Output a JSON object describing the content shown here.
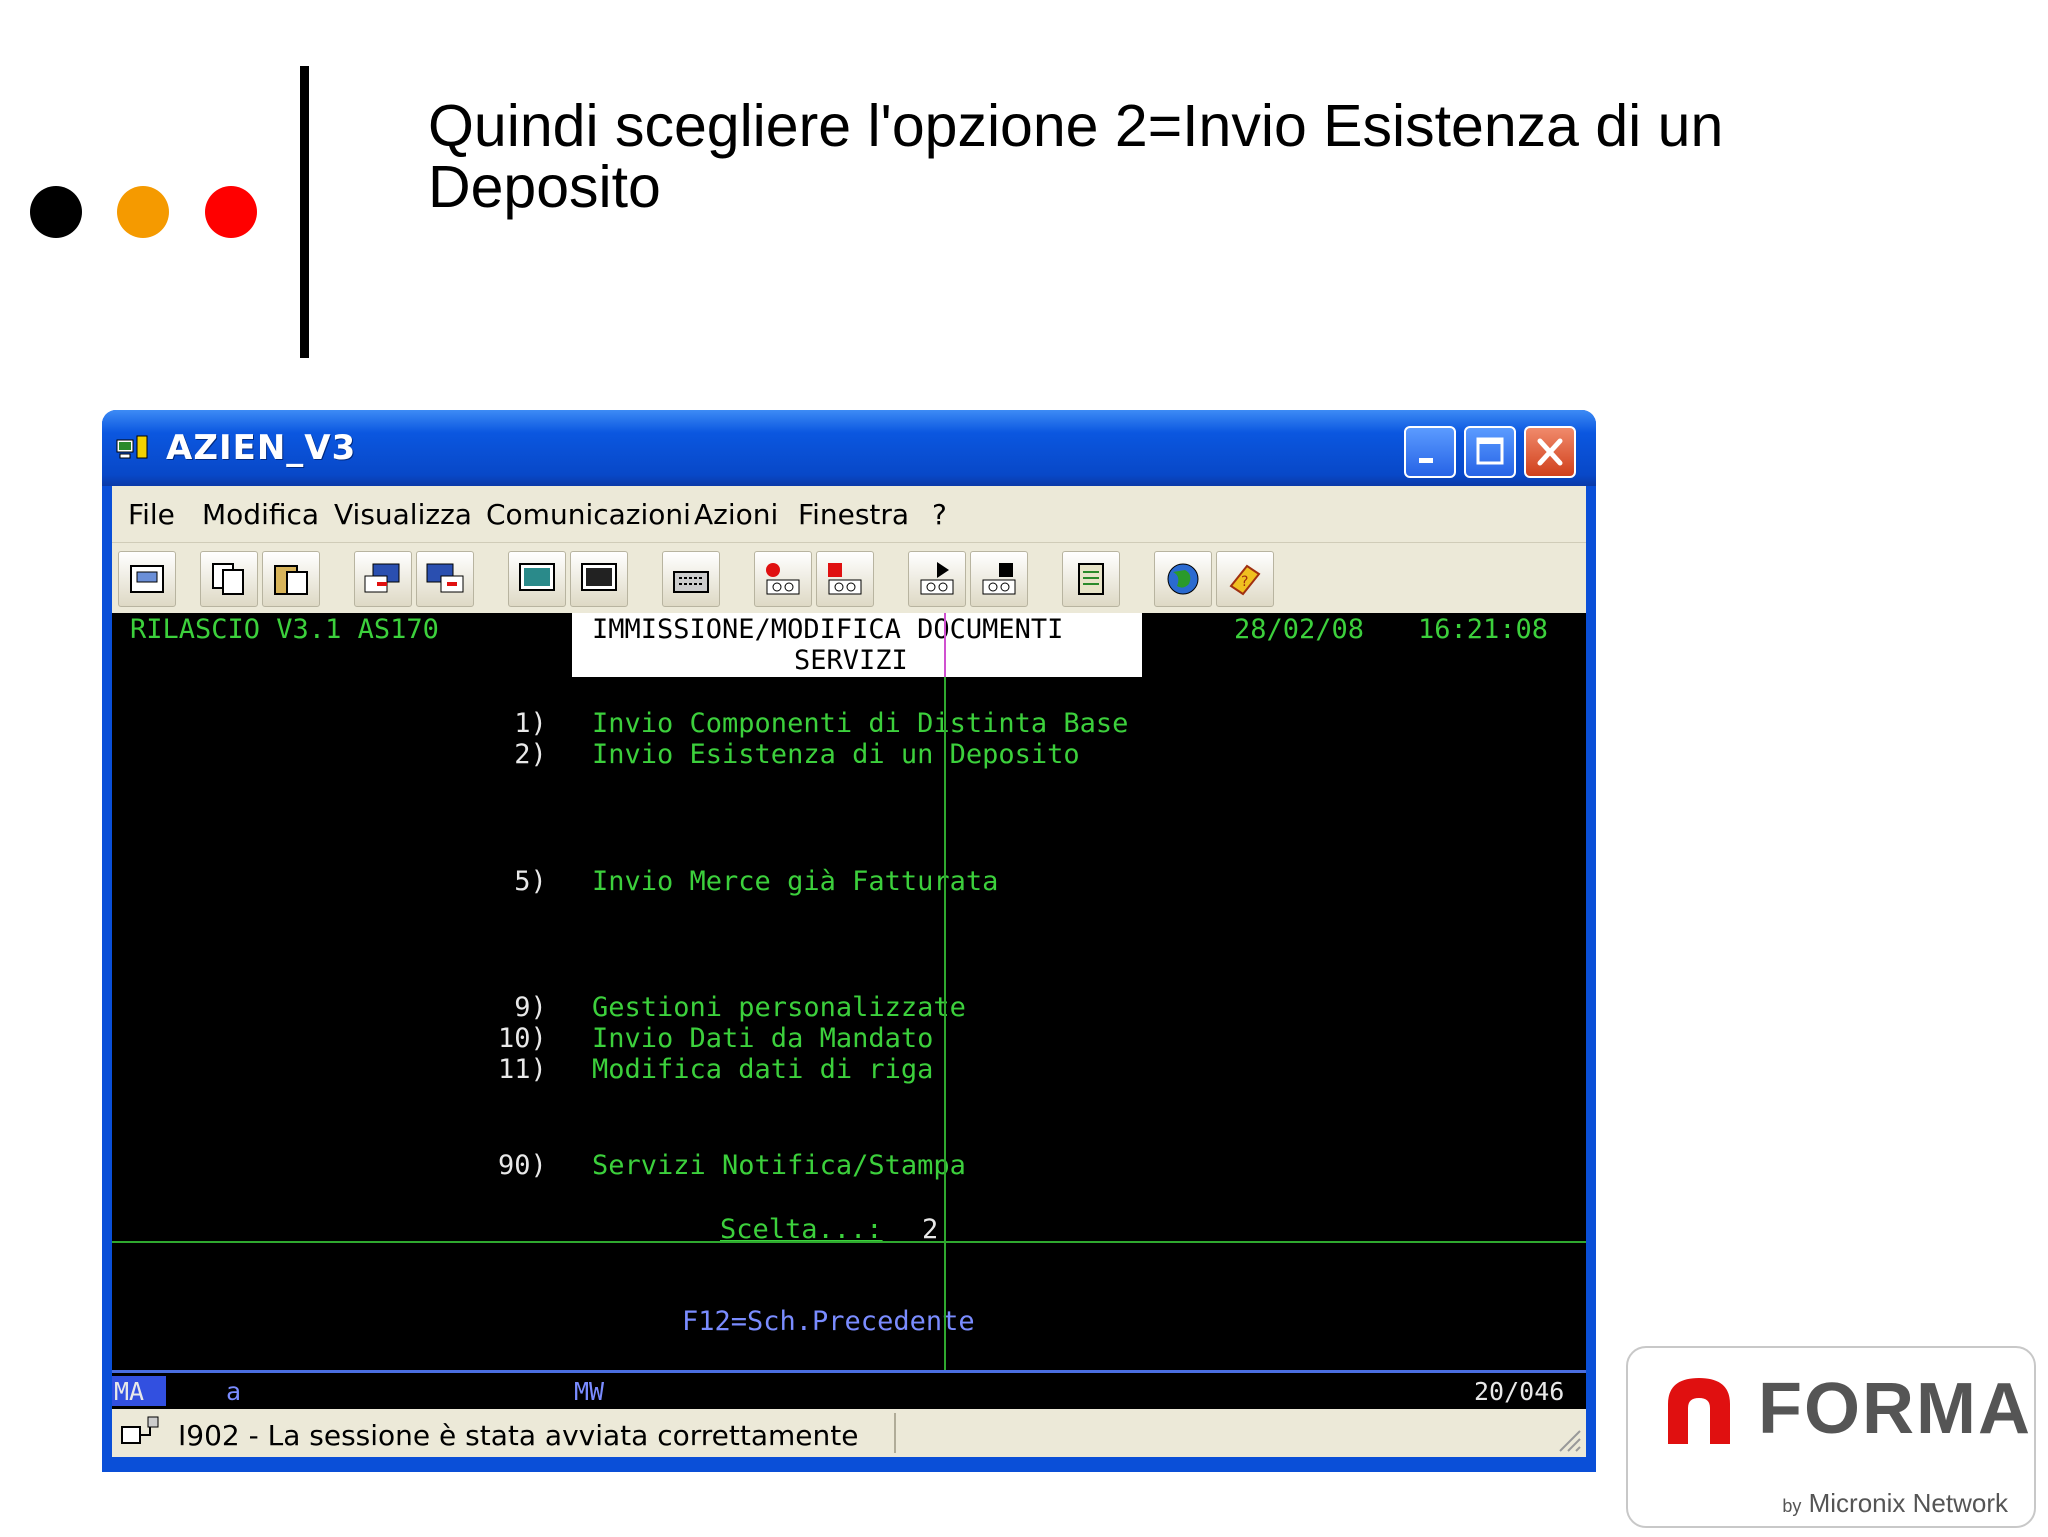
{
  "slide": {
    "title": "Quindi scegliere l'opzione 2=Invio Esistenza di un Deposito"
  },
  "window": {
    "title": "AZIEN_V3",
    "menu": [
      "File",
      "Modifica",
      "Visualizza",
      "Comunicazioni",
      "Azioni",
      "Finestra",
      "?"
    ]
  },
  "terminal": {
    "release": "RILASCIO V3.1 AS170",
    "header_line1": "IMMISSIONE/MODIFICA DOCUMENTI",
    "header_line2": "SERVIZI",
    "date": "28/02/08",
    "time": "16:21:08",
    "options": [
      {
        "num": " 1)",
        "label": "Invio Componenti di Distinta Base"
      },
      {
        "num": " 2)",
        "label": "Invio Esistenza di un Deposito"
      },
      {
        "num": " 5)",
        "label": "Invio Merce già Fatturata"
      },
      {
        "num": " 9)",
        "label": "Gestioni personalizzate"
      },
      {
        "num": "10)",
        "label": "Invio Dati da Mandato"
      },
      {
        "num": "11)",
        "label": "Modifica dati di riga"
      },
      {
        "num": "90)",
        "label": "Servizi Notifica/Stampa"
      }
    ],
    "choice_label": "Scelta...:",
    "choice_value": "2",
    "fkey": "F12=Sch.Precedente"
  },
  "oia": {
    "mode": "MA",
    "indicator": "a",
    "session": "MW",
    "position": "20/046"
  },
  "status": {
    "message": "I902 - La sessione è stata avviata correttamente"
  },
  "logo": {
    "word": "FORMA",
    "by": "by",
    "network": "Micronix Network"
  },
  "colors": {
    "terminal_green": "#3cd03c",
    "terminal_bg": "#000000",
    "title_bar": "#0b57e0",
    "logo_red": "#e01010"
  }
}
